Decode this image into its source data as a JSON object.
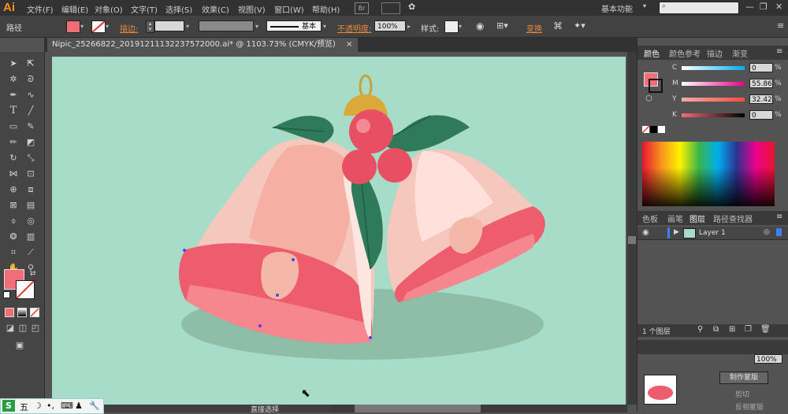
{
  "app": {
    "logo": "Ai"
  },
  "menu": [
    "文件(F)",
    "编辑(E)",
    "对象(O)",
    "文字(T)",
    "选择(S)",
    "效果(C)",
    "视图(V)",
    "窗口(W)",
    "帮助(H)"
  ],
  "workspace": {
    "label": "基本功能"
  },
  "control": {
    "object_label": "路径",
    "stroke_label": "描边:",
    "brush_label": "基本",
    "opacity_label": "不透明度:",
    "opacity_value": "100%",
    "style_label": "样式:",
    "transform_label": "变换"
  },
  "document": {
    "tab_title": "Nipic_25266822_20191211132237572000.ai* @ 1103.73% (CMYK/预览)",
    "close": "×"
  },
  "color_panel": {
    "tabs": [
      "颜色",
      "颜色参考",
      "描边",
      "渐变"
    ],
    "channels": [
      {
        "label": "C",
        "value": "0",
        "percent": "%"
      },
      {
        "label": "M",
        "value": "55.86",
        "percent": "%"
      },
      {
        "label": "Y",
        "value": "32.42",
        "percent": "%"
      },
      {
        "label": "K",
        "value": "0",
        "percent": "%"
      }
    ]
  },
  "layers_panel": {
    "tabs": [
      "色板",
      "画笔",
      "图层",
      "路径查找器"
    ],
    "layers": [
      {
        "name": "Layer 1"
      }
    ],
    "footer_count": "1 个图层"
  },
  "bottom_panel": {
    "btn_make_mask": "制作蒙版",
    "cut": "剪切",
    "invert_mask": "反相蒙版",
    "opacity_value": "100%"
  },
  "statusbar": {
    "tool_name": "直接选择"
  },
  "taskbar": {
    "ime_items": [
      "五",
      "☽",
      "•,",
      "⌨",
      "♟",
      "🔧"
    ]
  },
  "colors": {
    "canvas_bg": "#a6dcc8",
    "bell_light": "#f6b5a9",
    "bell_inner": "#ee5d6d",
    "leaf": "#2f7a5a",
    "berry": "#e94f62",
    "fill_color": "#f16d78"
  }
}
